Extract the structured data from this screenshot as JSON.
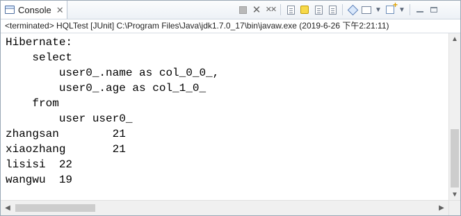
{
  "tab": {
    "label": "Console",
    "close_glyph": "✕"
  },
  "status": {
    "text": "<terminated> HQLTest [JUnit] C:\\Program Files\\Java\\jdk1.7.0_17\\bin\\javaw.exe (2019-6-26 下午2:21:11)"
  },
  "console": {
    "lines": [
      "Hibernate:",
      "    select",
      "        user0_.name as col_0_0_,",
      "        user0_.age as col_1_0_",
      "    from",
      "        user user0_",
      "zhangsan        21",
      "xiaozhang       21",
      "lisisi  22",
      "wangwu  19"
    ]
  },
  "toolbar": {
    "icons": [
      "terminate-icon",
      "remove-launch-icon",
      "remove-all-terminated-icon",
      "clear-console-icon",
      "scroll-lock-icon",
      "word-wrap-icon",
      "show-console-when-output-changes-icon",
      "pin-console-icon",
      "display-selected-console-icon",
      "open-console-icon",
      "minimize-icon",
      "maximize-icon"
    ]
  },
  "colors": {
    "background": "#ffffff",
    "title_bar": "#edf1f6",
    "border": "#9aa7b5",
    "scroll_thumb": "#cdcdcd",
    "text": "#000000"
  }
}
